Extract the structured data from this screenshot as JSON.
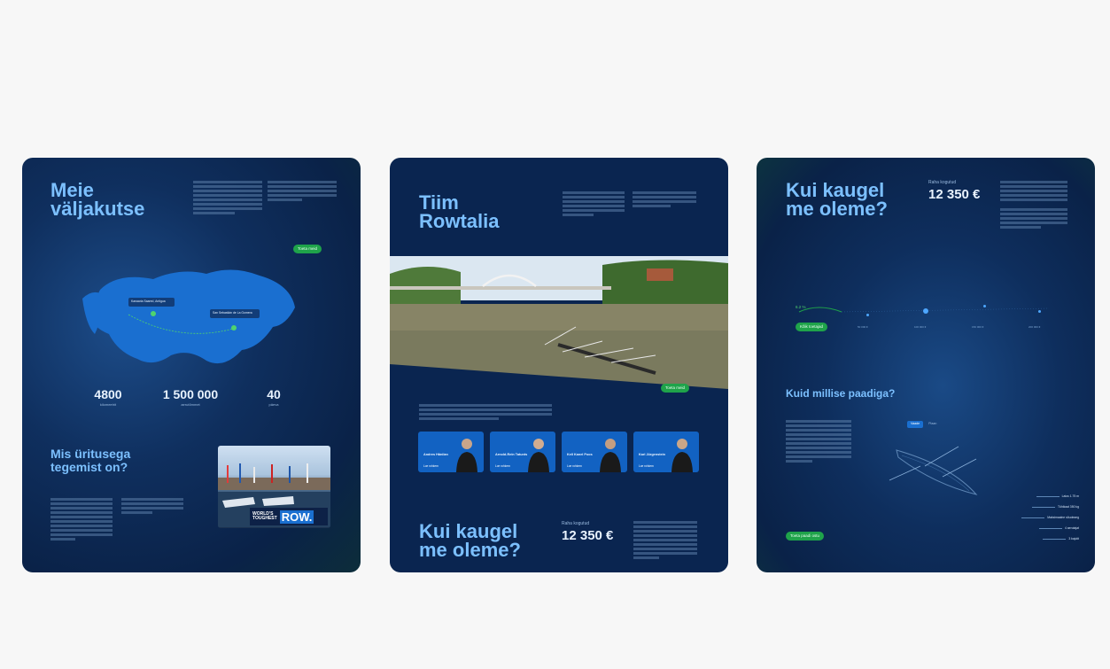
{
  "panel1": {
    "title_line1": "Meie",
    "title_line2": "väljakutse",
    "cta": "Toeta meid",
    "map_label_start": "Kanaaria Saared, Antigua",
    "map_label_end": "San Sebastián de La Gomera",
    "stats": [
      {
        "value": "4800",
        "label": "kilomeetrit"
      },
      {
        "value": "1 500 000",
        "label": "aerutõmmet"
      },
      {
        "value": "40",
        "label": "päeva"
      }
    ],
    "subtitle_line1": "Mis üritusega",
    "subtitle_line2": "tegemist on?",
    "badge_line1": "WORLD'S",
    "badge_line2": "TOUGHEST",
    "badge_row": "ROW."
  },
  "panel2": {
    "title_line1": "Tiim",
    "title_line2": "Rowtalia",
    "cta": "Toeta meid",
    "team": [
      {
        "name": "Andres Hänilan",
        "link": "Loe rohkem"
      },
      {
        "name": "Arnold-Rein Tatunts",
        "link": "Loe rohkem"
      },
      {
        "name": "Kell Kanel Poos",
        "link": "Loe rohkem"
      },
      {
        "name": "Karl Jürgenstein",
        "link": "Loe rohkem"
      }
    ],
    "bottom_title_line1": "Kui kaugel",
    "bottom_title_line2": "me oleme?",
    "raised_label": "Raha kogutud",
    "raised_amount": "12 350 €"
  },
  "panel3": {
    "title_line1": "Kui kaugel",
    "title_line2": "me oleme?",
    "raised_label": "Raha kogutud",
    "raised_amount": "12 350 €",
    "progress_pct": "6.2 %",
    "cta": "Kõik toetajad",
    "milestones": [
      "50 000 €",
      "100 000 €",
      "150 000 €",
      "200 000 €"
    ],
    "boat_title": "Kuid millise paadiga?",
    "tabs": [
      "Vaade",
      "Plaan"
    ],
    "specs": [
      "Laius 1.75 m",
      "Tühikaal 350 kg",
      "Maksimaalne sõudeaeg",
      "4 aerutajat",
      "3 kajutit"
    ],
    "cta2": "Toeta paadi ostu"
  },
  "colors": {
    "accent": "#1fa34a",
    "title": "#7cc0ff",
    "panel": "#0a2550"
  }
}
